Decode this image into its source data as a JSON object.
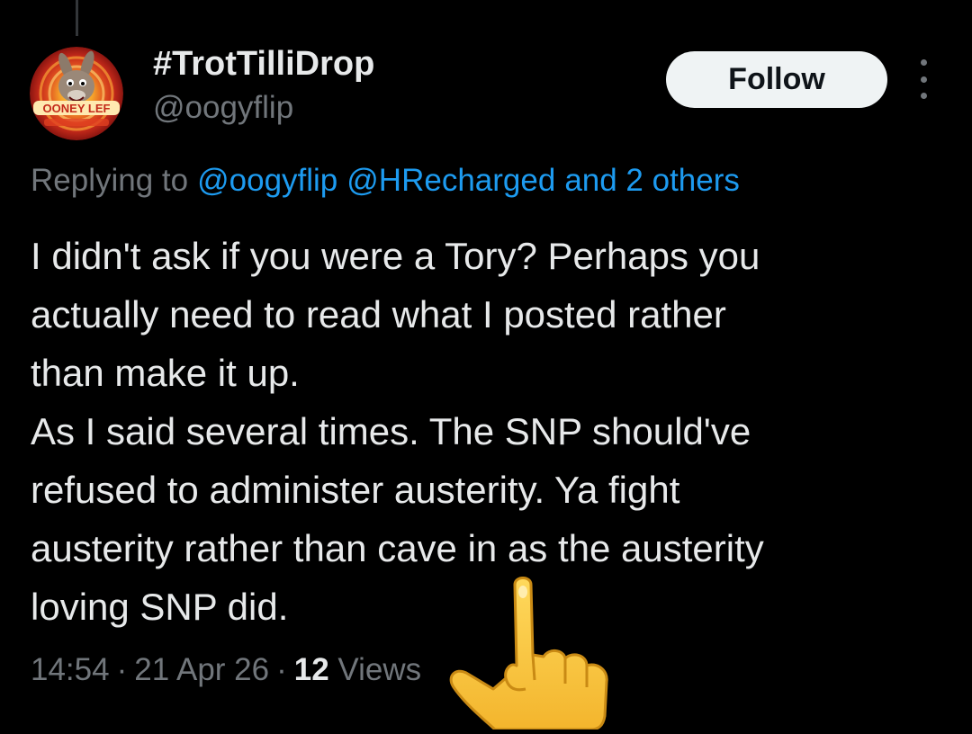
{
  "tweet": {
    "author": {
      "display_name": "#TrotTilliDrop",
      "handle": "@oogyflip",
      "avatar_text": "OONEY LEF"
    },
    "follow_label": "Follow",
    "reply": {
      "prefix": "Replying to",
      "mention_1": "@oogyflip",
      "mention_2": "@HRecharged",
      "others": "and 2 others"
    },
    "text_lines": [
      "I didn't ask if you were a Tory? Perhaps you",
      "actually need to read what I posted rather",
      "than make it up.",
      "As I said several times. The SNP should've",
      "refused to administer austerity. Ya fight",
      "austerity rather than cave in as the austerity",
      "loving SNP did."
    ],
    "time": "14:54",
    "date": "21 Apr 26",
    "separator": "·",
    "views_count": "12",
    "views_label": "Views"
  },
  "icons": {
    "more": "more-vertical-icon",
    "emoji": "middle-finger-emoji"
  },
  "colors": {
    "background": "#000000",
    "text": "#e7e9ea",
    "secondary": "#71767b",
    "link": "#1d9bf0",
    "follow_bg": "#eff3f4"
  }
}
